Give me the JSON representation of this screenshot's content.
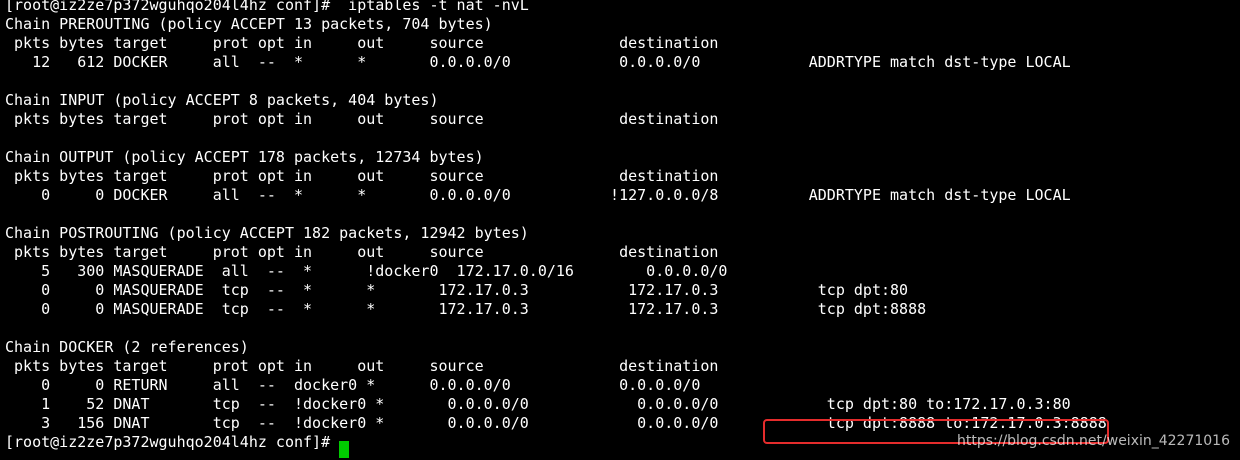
{
  "terminal": {
    "background": "#000000",
    "foreground": "#ffffff",
    "cursor_color": "#00cc00",
    "highlight_color": "#e52c2c",
    "lines": [
      "[root@iz2ze7p372wguhqo204l4hz conf]#  iptables -t nat -nvL",
      "Chain PREROUTING (policy ACCEPT 13 packets, 704 bytes)",
      " pkts bytes target     prot opt in     out     source               destination",
      "   12   612 DOCKER     all  --  *      *       0.0.0.0/0            0.0.0.0/0            ADDRTYPE match dst-type LOCAL",
      "",
      "Chain INPUT (policy ACCEPT 8 packets, 404 bytes)",
      " pkts bytes target     prot opt in     out     source               destination",
      "",
      "Chain OUTPUT (policy ACCEPT 178 packets, 12734 bytes)",
      " pkts bytes target     prot opt in     out     source               destination",
      "    0     0 DOCKER     all  --  *      *       0.0.0.0/0           !127.0.0.0/8          ADDRTYPE match dst-type LOCAL",
      "",
      "Chain POSTROUTING (policy ACCEPT 182 packets, 12942 bytes)",
      " pkts bytes target     prot opt in     out     source               destination",
      "    5   300 MASQUERADE  all  --  *      !docker0  172.17.0.0/16        0.0.0.0/0",
      "    0     0 MASQUERADE  tcp  --  *      *       172.17.0.3           172.17.0.3           tcp dpt:80",
      "    0     0 MASQUERADE  tcp  --  *      *       172.17.0.3           172.17.0.3           tcp dpt:8888",
      "",
      "Chain DOCKER (2 references)",
      " pkts bytes target     prot opt in     out     source               destination",
      "    0     0 RETURN     all  --  docker0 *      0.0.0.0/0            0.0.0.0/0",
      "    1    52 DNAT       tcp  --  !docker0 *       0.0.0.0/0            0.0.0.0/0            tcp dpt:80 to:172.17.0.3:80",
      "    3   156 DNAT       tcp  --  !docker0 *       0.0.0.0/0            0.0.0.0/0            tcp dpt:8888 to:172.17.0.3:8888",
      "[root@iz2ze7p372wguhqo204l4hz conf]# "
    ]
  },
  "watermark": {
    "text": "https://blog.csdn.net/weixin_42271016"
  }
}
